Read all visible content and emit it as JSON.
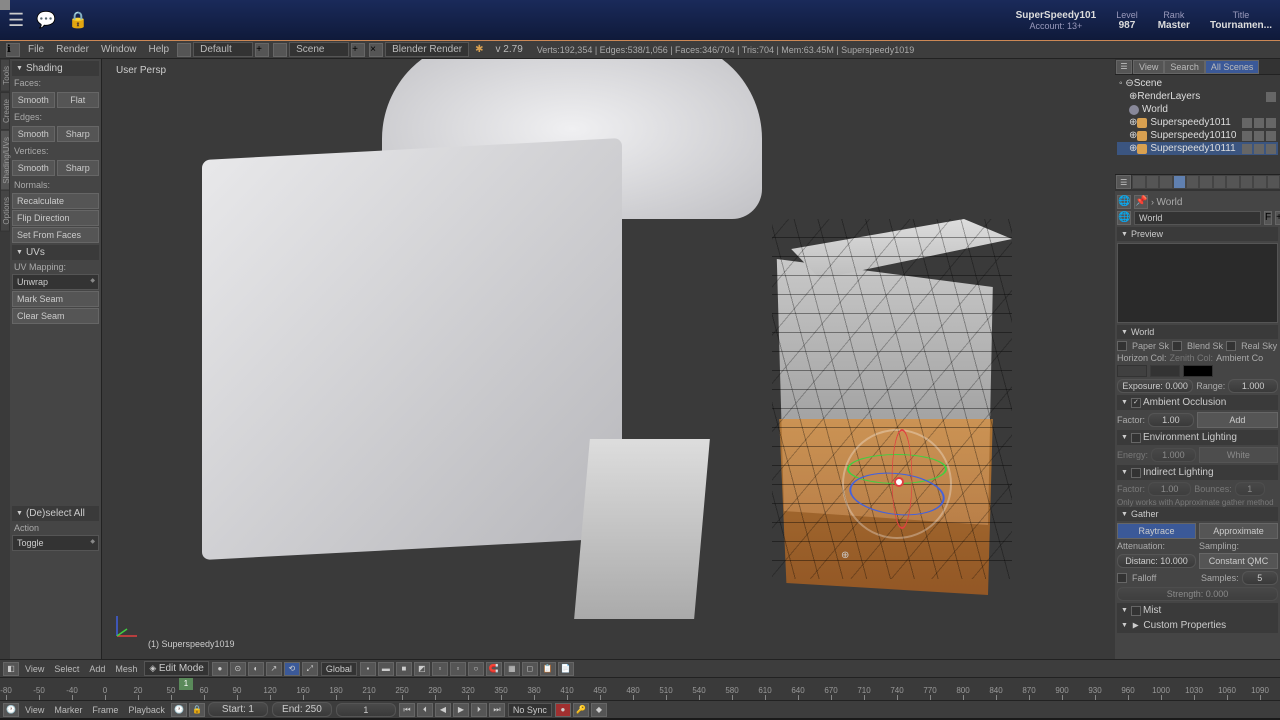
{
  "topbar": {
    "user": "SuperSpeedy101",
    "account": "Account: 13+",
    "stats": [
      {
        "label": "Level",
        "value": "987"
      },
      {
        "label": "Rank",
        "value": "Master"
      },
      {
        "label": "Title",
        "value": "Tournamen..."
      }
    ]
  },
  "menubar": {
    "items": [
      "File",
      "Render",
      "Window",
      "Help"
    ],
    "layout": "Default",
    "scene": "Scene",
    "renderer": "Blender Render",
    "version": "v 2.79",
    "stats": "Verts:192,354 | Edges:538/1,056 | Faces:346/704 | Tris:704 | Mem:63.45M | Superspeedy1019"
  },
  "left_panel": {
    "shading": {
      "title": "Shading",
      "faces": "Faces:",
      "edges": "Edges:",
      "vertices": "Vertices:",
      "normals": "Normals:",
      "smooth": "Smooth",
      "flat": "Flat",
      "sharp": "Sharp",
      "recalculate": "Recalculate",
      "flip_direction": "Flip Direction",
      "set_from_faces": "Set From Faces"
    },
    "uvs": {
      "title": "UVs",
      "uv_mapping": "UV Mapping:",
      "unwrap": "Unwrap",
      "mark_seam": "Mark Seam",
      "clear_seam": "Clear Seam"
    },
    "action": {
      "title": "(De)select All",
      "label": "Action",
      "toggle": "Toggle"
    }
  },
  "viewport": {
    "persp": "User Persp",
    "object_name": "(1) Superspeedy1019"
  },
  "viewport_toolbar": {
    "view": "View",
    "select": "Select",
    "add": "Add",
    "mesh": "Mesh",
    "mode": "Edit Mode",
    "orientation": "Global"
  },
  "outliner": {
    "view": "View",
    "search": "Search",
    "all_scenes": "All Scenes",
    "tree": {
      "scene": "Scene",
      "render_layers": "RenderLayers",
      "world": "World",
      "items": [
        "Superspeedy1011",
        "Superspeedy10110",
        "Superspeedy10111"
      ]
    }
  },
  "props": {
    "world_ctx": "World",
    "world_name": "World",
    "preview": "Preview",
    "world_section": "World",
    "paper_sk": "Paper Sk",
    "blend_sk": "Blend Sk",
    "real_sky": "Real Sky",
    "horizon_col": "Horizon Col:",
    "zenith_col": "Zenith Col:",
    "ambient_co": "Ambient Co",
    "exposure": "Exposure: 0.000",
    "range": "Range:",
    "range_val": "1.000",
    "ambient_occlusion": "Ambient Occlusion",
    "factor": "Factor:",
    "factor_val": "1.00",
    "add": "Add",
    "env_lighting": "Environment Lighting",
    "energy": "Energy:",
    "energy_val": "1.000",
    "white": "White",
    "indirect_lighting": "Indirect Lighting",
    "bounces": "Bounces:",
    "bounces_val": "1",
    "indirect_note": "Only works with Approximate gather method",
    "gather": "Gather",
    "raytrace": "Raytrace",
    "approximate": "Approximate",
    "attenuation": "Attenuation:",
    "sampling": "Sampling:",
    "distanc": "Distanc: 10.000",
    "constant_qmc": "Constant QMC",
    "falloff": "Falloff",
    "samples": "Samples:",
    "samples_val": "5",
    "strength": "Strength: 0.000",
    "mist": "Mist",
    "custom_props": "Custom Properties"
  },
  "timeline": {
    "view": "View",
    "marker": "Marker",
    "frame": "Frame",
    "playback": "Playback",
    "start": "Start:",
    "start_val": "1",
    "end": "End:",
    "end_val": "250",
    "current": "1",
    "no_sync": "No Sync",
    "ticks": [
      -80,
      -50,
      -40,
      0,
      20,
      50,
      60,
      90,
      120,
      160,
      180,
      210,
      250,
      280,
      320,
      350,
      380,
      410,
      450,
      480,
      510,
      540,
      580,
      610,
      640,
      670,
      710,
      740,
      770,
      800,
      840,
      870,
      900,
      930,
      960,
      1000,
      1030,
      1060,
      1090
    ]
  }
}
